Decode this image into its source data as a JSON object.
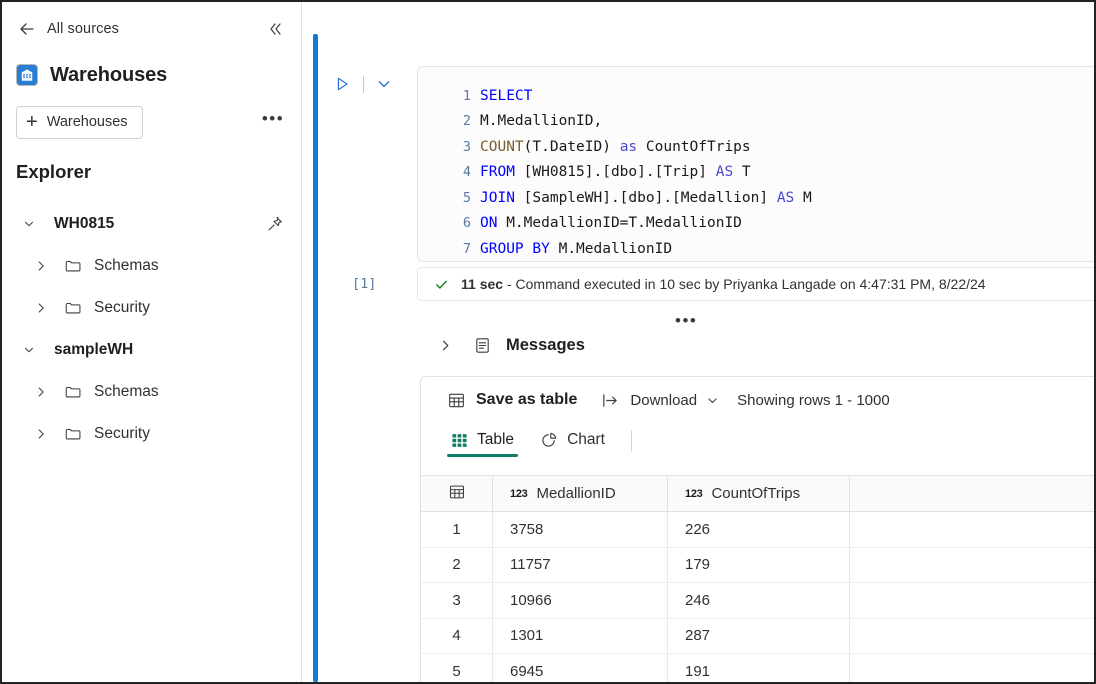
{
  "sidebar": {
    "back_label": "All sources",
    "collapse_icon": "double-chevron-left-icon",
    "workspace_title": "Warehouses",
    "workspace_icon": "warehouse-icon",
    "new_button_label": "Warehouses",
    "new_button_icon": "plus-icon",
    "overflow_icon": "ellipsis-icon",
    "explorer_title": "Explorer",
    "tree": [
      {
        "label": "WH0815",
        "icon": "chevron-down-icon",
        "expanded": true,
        "pin_icon": "pin-icon",
        "children": [
          {
            "label": "Schemas",
            "icon": "chevron-right-icon",
            "folder_icon": "folder-icon"
          },
          {
            "label": "Security",
            "icon": "chevron-right-icon",
            "folder_icon": "folder-icon"
          }
        ]
      },
      {
        "label": "sampleWH",
        "icon": "chevron-down-icon",
        "expanded": true,
        "children": [
          {
            "label": "Schemas",
            "icon": "chevron-right-icon",
            "folder_icon": "folder-icon"
          },
          {
            "label": "Security",
            "icon": "chevron-right-icon",
            "folder_icon": "folder-icon"
          }
        ]
      }
    ]
  },
  "editor": {
    "run_icon": "play-triangle-icon",
    "options_icon": "chevron-down-icon",
    "cell_index": "[1]",
    "cell_overflow_icon": "ellipsis-icon",
    "lines": [
      {
        "n": "1",
        "text": "SELECT"
      },
      {
        "n": "2",
        "text": "M.MedallionID,"
      },
      {
        "n": "3",
        "text": "COUNT(T.DateID) as CountOfTrips"
      },
      {
        "n": "4",
        "text": "FROM [WH0815].[dbo].[Trip] AS T"
      },
      {
        "n": "5",
        "text": "JOIN [SampleWH].[dbo].[Medallion] AS M"
      },
      {
        "n": "6",
        "text": "ON M.MedallionID=T.MedallionID"
      },
      {
        "n": "7",
        "text": "GROUP BY M.MedallionID"
      }
    ]
  },
  "status": {
    "check_icon": "checkmark-icon",
    "duration": "11 sec",
    "message": " - Command executed in 10 sec by Priyanka Langade on 4:47:31 PM, 8/22/24"
  },
  "messages": {
    "chevron_icon": "chevron-right-icon",
    "icon": "message-list-icon",
    "label": "Messages"
  },
  "results": {
    "save_as_table_label": "Save as table",
    "save_as_table_icon": "table-icon",
    "download_label": "Download",
    "download_icon": "download-arrow-icon",
    "download_chevron_icon": "chevron-down-icon",
    "showing_rows_label": "Showing rows 1 - 1000",
    "tabs": [
      {
        "label": "Table",
        "icon": "grid-icon",
        "active": true
      },
      {
        "label": "Chart",
        "icon": "pie-chart-icon",
        "active": false
      }
    ],
    "accent_color": "#107c68",
    "grid": {
      "corner_icon": "table-icon",
      "columns": [
        {
          "name": "MedallionID",
          "type_badge": "123"
        },
        {
          "name": "CountOfTrips",
          "type_badge": "123"
        }
      ],
      "rows": [
        {
          "index": "1",
          "MedallionID": "3758",
          "CountOfTrips": "226"
        },
        {
          "index": "2",
          "MedallionID": "11757",
          "CountOfTrips": "179"
        },
        {
          "index": "3",
          "MedallionID": "10966",
          "CountOfTrips": "246"
        },
        {
          "index": "4",
          "MedallionID": "1301",
          "CountOfTrips": "287"
        },
        {
          "index": "5",
          "MedallionID": "6945",
          "CountOfTrips": "191"
        }
      ]
    }
  },
  "colors": {
    "accent_blue": "#0f7bd4",
    "tab_green": "#107c68",
    "success_green": "#107c10",
    "keyword_blue": "#0000ff"
  }
}
